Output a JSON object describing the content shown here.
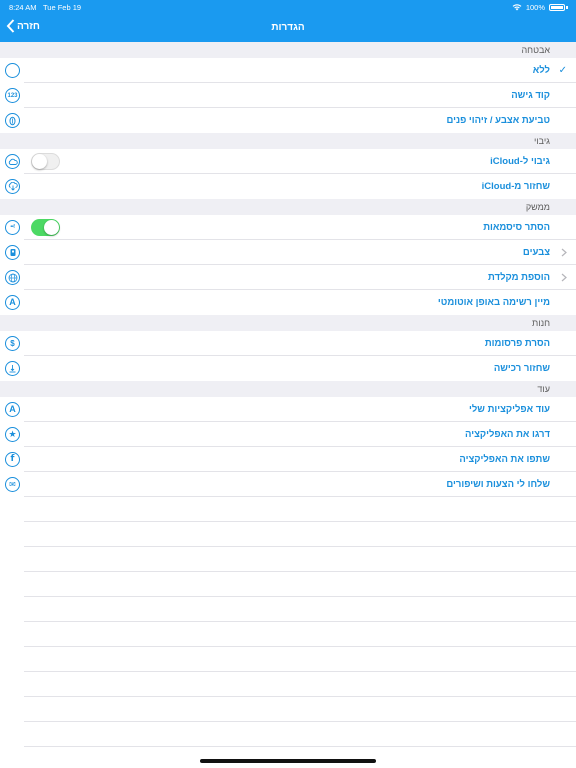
{
  "status_bar": {
    "time": "8:24 AM",
    "date": "Tue Feb 19",
    "battery": "100%"
  },
  "nav": {
    "title": "הגדרות",
    "back_label": "חזרה"
  },
  "colors": {
    "accent": "#1a8fdc",
    "nav_bg": "#1a9af0",
    "toggle_on": "#4cd964"
  },
  "sections": {
    "security": {
      "title": "אבטחה",
      "items": [
        {
          "label": "ללא",
          "icon_text": "",
          "icon": "circle-icon",
          "checked": true
        },
        {
          "label": "קוד גישה",
          "icon_text": "123",
          "icon": "passcode-icon"
        },
        {
          "label": "טביעת אצבע / זיהוי פנים",
          "icon_text": "",
          "icon": "fingerprint-icon"
        }
      ]
    },
    "backup": {
      "title": "גיבוי",
      "items": [
        {
          "label": "גיבוי ל-iCloud",
          "icon": "cloud-icon",
          "toggle": false
        },
        {
          "label": "שחזור מ-iCloud",
          "icon": "cloud-download-icon"
        }
      ]
    },
    "interface": {
      "title": "ממשק",
      "items": [
        {
          "label": "הסתר סיסמאות",
          "icon_text": "••!",
          "icon": "hide-passwords-icon",
          "toggle": true
        },
        {
          "label": "צבעים",
          "icon": "colors-icon",
          "chevron": true
        },
        {
          "label": "הוספת מקלדת",
          "icon": "globe-icon",
          "chevron": true
        },
        {
          "label": "מיין רשימה באופן אוטומטי",
          "icon_text": "A",
          "icon": "sort-icon"
        }
      ]
    },
    "store": {
      "title": "חנות",
      "items": [
        {
          "label": "הסרת פרסומות",
          "icon_text": "$",
          "icon": "dollar-icon"
        },
        {
          "label": "שחזור רכישה",
          "icon": "restore-icon"
        }
      ]
    },
    "more": {
      "title": "עוד",
      "items": [
        {
          "label": "עוד אפליקציות שלי",
          "icon_text": "A",
          "icon": "app-store-icon"
        },
        {
          "label": "דרגו את האפליקציה",
          "icon_text": "★",
          "icon": "star-icon"
        },
        {
          "label": "שתפו את האפליקציה",
          "icon_text": "f",
          "icon": "facebook-icon"
        },
        {
          "label": "שלחו לי הצעות ושיפורים",
          "icon_text": "✉",
          "icon": "mail-icon"
        }
      ]
    }
  }
}
